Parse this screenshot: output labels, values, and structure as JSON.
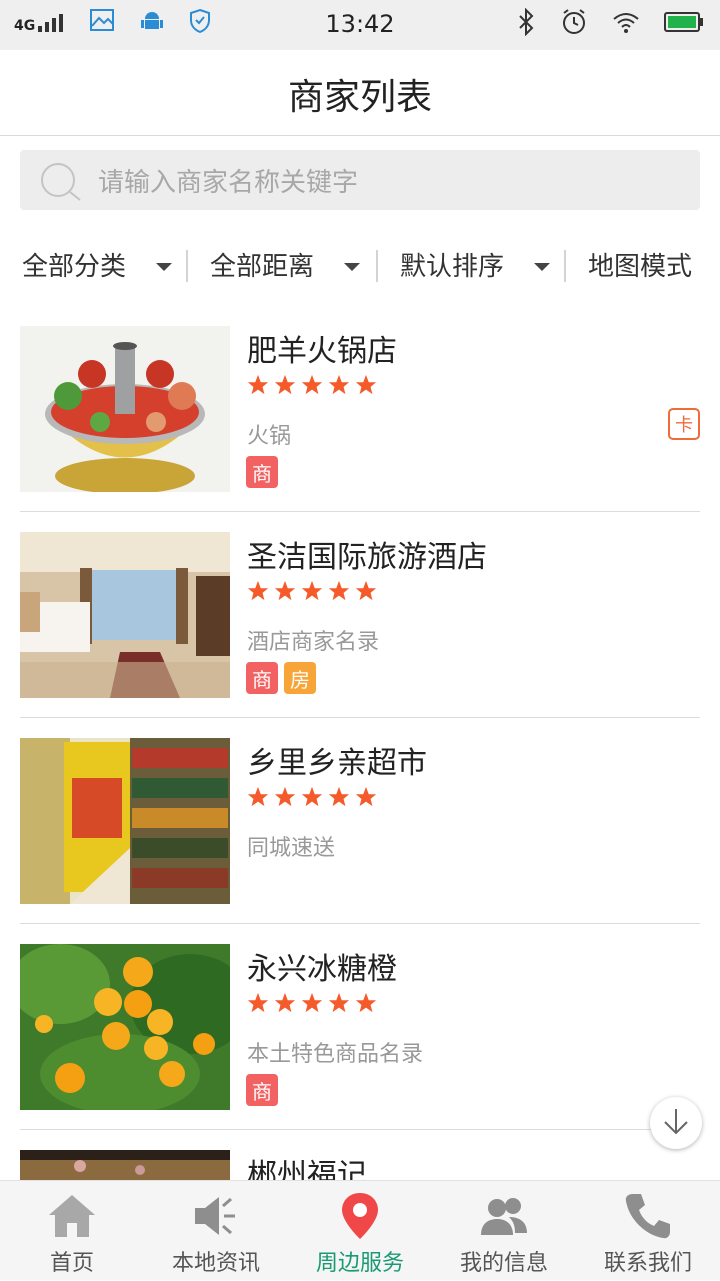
{
  "status_bar": {
    "network": "4G",
    "time": "13:42"
  },
  "header": {
    "title": "商家列表"
  },
  "search": {
    "placeholder": "请输入商家名称关键字"
  },
  "filters": [
    {
      "label": "全部分类"
    },
    {
      "label": "全部距离"
    },
    {
      "label": "默认排序"
    },
    {
      "label": "地图模式"
    }
  ],
  "merchants": [
    {
      "name": "肥羊火锅店",
      "category": "火锅",
      "rating": 5,
      "badges": [
        "商"
      ],
      "card_tag": "卡",
      "image": "hotpot"
    },
    {
      "name": "圣洁国际旅游酒店",
      "category": "酒店商家名录",
      "rating": 5,
      "badges": [
        "商",
        "房"
      ],
      "image": "hotel-room"
    },
    {
      "name": "乡里乡亲超市",
      "category": "同城速送",
      "rating": 5,
      "badges": [],
      "image": "supermarket"
    },
    {
      "name": "永兴冰糖橙",
      "category": "本土特色商品名录",
      "rating": 5,
      "badges": [
        "商"
      ],
      "image": "orange-tree"
    },
    {
      "name": "郴州福记",
      "image": "tea-table"
    }
  ],
  "tabs": [
    {
      "label": "首页",
      "icon": "home-icon"
    },
    {
      "label": "本地资讯",
      "icon": "megaphone-icon"
    },
    {
      "label": "周边服务",
      "icon": "location-pin-icon",
      "active": true
    },
    {
      "label": "我的信息",
      "icon": "users-icon"
    },
    {
      "label": "联系我们",
      "icon": "phone-icon"
    }
  ],
  "colors": {
    "star": "#f55a2a",
    "badge_red": "#f26262",
    "badge_orange": "#f7a538",
    "active_tab": "#1a9a73",
    "active_tab_icon": "#f04848"
  }
}
